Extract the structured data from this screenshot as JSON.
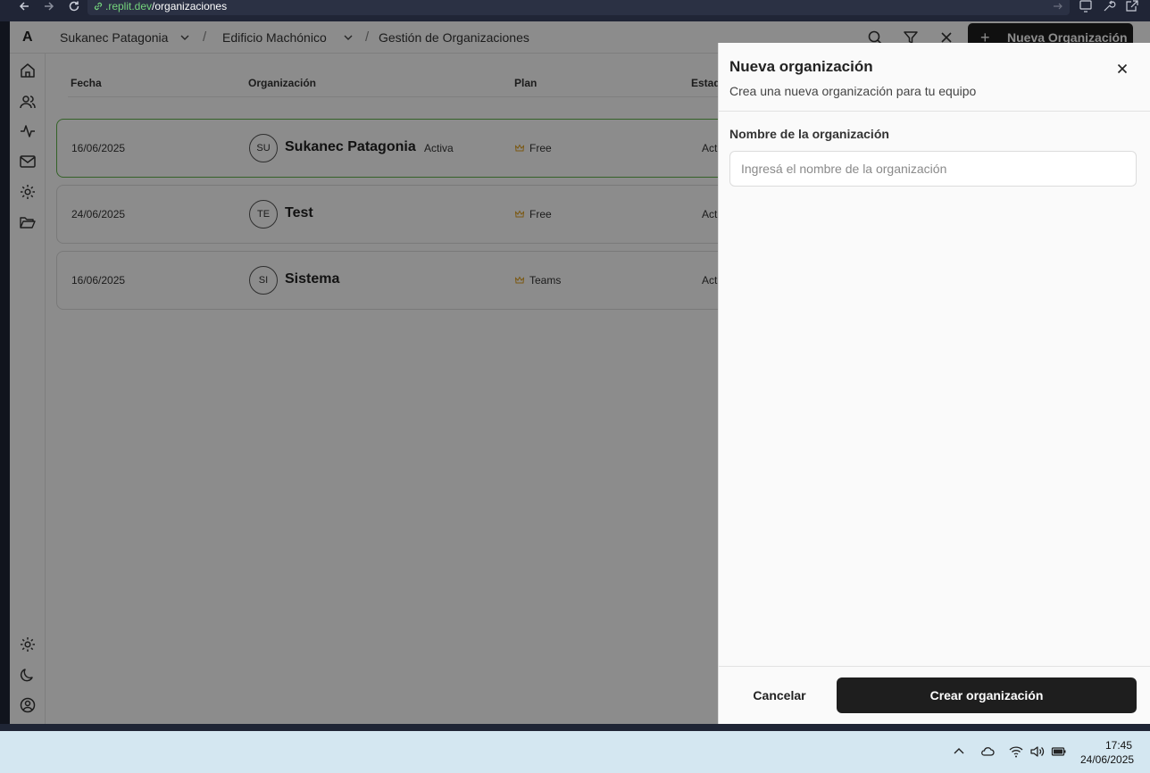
{
  "browser": {
    "url_domain": ".replit.dev",
    "url_path": "/organizaciones"
  },
  "header": {
    "logo": "A",
    "breadcrumb": [
      "Sukanec Patagonia",
      "Edificio Machónico",
      "Gestión de Organizaciones"
    ],
    "separator": "/",
    "new_org_button": "Nueva Organización",
    "new_org_plus": "+"
  },
  "table": {
    "columns": [
      "Fecha",
      "Organización",
      "Plan",
      "Estad"
    ],
    "rows": [
      {
        "date": "16/06/2025",
        "initials": "SU",
        "name": "Sukanec Patagonia",
        "status": "Activa",
        "plan": "Free",
        "estado": "Act",
        "selected": true
      },
      {
        "date": "24/06/2025",
        "initials": "TE",
        "name": "Test",
        "status": "",
        "plan": "Free",
        "estado": "Act",
        "selected": false
      },
      {
        "date": "16/06/2025",
        "initials": "SI",
        "name": "Sistema",
        "status": "",
        "plan": "Teams",
        "estado": "Act",
        "selected": false
      }
    ]
  },
  "drawer": {
    "title": "Nueva organización",
    "subtitle": "Crea una nueva organización para tu equipo",
    "field_label": "Nombre de la organización",
    "field_placeholder": "Ingresá el nombre de la organización",
    "field_value": "",
    "cancel": "Cancelar",
    "submit": "Crear organización"
  },
  "taskbar": {
    "time": "17:45",
    "date": "24/06/2025"
  },
  "colors": {
    "accent_dark": "#1e1e1e",
    "selected_row_border": "#5fb24a",
    "url_domain": "#74d37c",
    "crown": "#e0a020"
  }
}
